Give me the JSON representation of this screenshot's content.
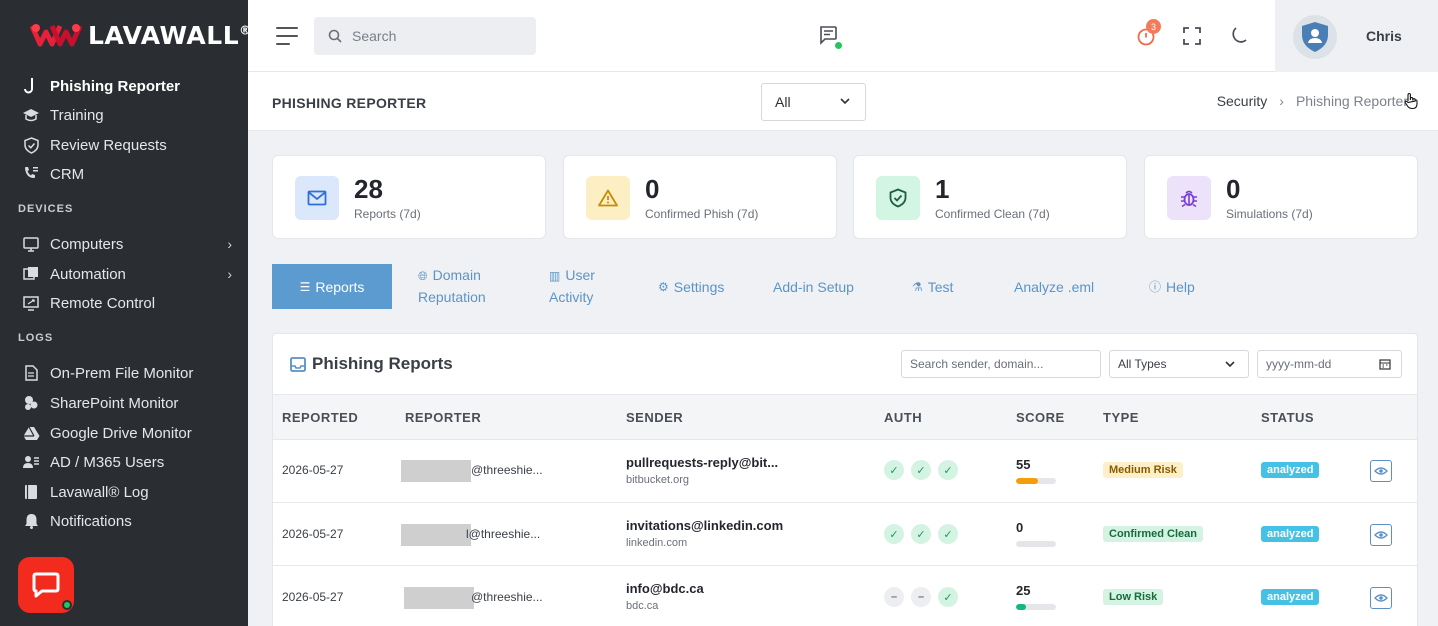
{
  "brand": {
    "name_a": "LAVA",
    "name_b": "WALL",
    "reg": "®"
  },
  "sidebar": {
    "items_top": [
      {
        "label": "Phishing Reporter",
        "icon": "hook-icon",
        "active": true
      },
      {
        "label": "Training",
        "icon": "graduation-cap-icon"
      },
      {
        "label": "Review Requests",
        "icon": "shield-check-icon"
      },
      {
        "label": "CRM",
        "icon": "phone-book-icon"
      }
    ],
    "section_devices": "DEVICES",
    "items_devices": [
      {
        "label": "Computers",
        "icon": "monitor-icon",
        "has_submenu": true
      },
      {
        "label": "Automation",
        "icon": "automation-icon",
        "has_submenu": true
      },
      {
        "label": "Remote Control",
        "icon": "remote-screen-icon"
      }
    ],
    "section_logs": "LOGS",
    "items_logs": [
      {
        "label": "On-Prem File Monitor",
        "icon": "file-icon"
      },
      {
        "label": "SharePoint Monitor",
        "icon": "sharepoint-icon"
      },
      {
        "label": "Google Drive Monitor",
        "icon": "drive-icon"
      },
      {
        "label": "AD / M365 Users",
        "icon": "users-icon"
      },
      {
        "label": "Lavawall® Log",
        "icon": "log-icon"
      },
      {
        "label": "Notifications",
        "icon": "bell-icon"
      }
    ]
  },
  "topbar": {
    "search_placeholder": "Search",
    "timer_badge": "3",
    "user_name": "Chris"
  },
  "pagehead": {
    "title": "PHISHING REPORTER",
    "filter_value": "All",
    "breadcrumb": [
      "Security",
      "Phishing Reporter"
    ]
  },
  "stats": [
    {
      "value": "28",
      "label": "Reports (7d)",
      "icon": "mail-icon",
      "bg": "#dbe7fb",
      "fg": "#2f6fd8"
    },
    {
      "value": "0",
      "label": "Confirmed Phish (7d)",
      "icon": "warning-icon",
      "bg": "#fcefc4",
      "fg": "#c98a06"
    },
    {
      "value": "1",
      "label": "Confirmed Clean (7d)",
      "icon": "shield-check-icon",
      "bg": "#d3f5e3",
      "fg": "#1c9a55"
    },
    {
      "value": "0",
      "label": "Simulations (7d)",
      "icon": "bug-icon",
      "bg": "#ece3fb",
      "fg": "#7a3fd0"
    }
  ],
  "tabs": [
    {
      "label": "Reports",
      "icon": "list-icon",
      "active": true
    },
    {
      "label_a": "Domain",
      "label_b": "Reputation",
      "icon": "globe-icon"
    },
    {
      "label_a": "User",
      "label_b": "Activity",
      "icon": "chart-icon"
    },
    {
      "label": "Settings",
      "icon": "gear-icon"
    },
    {
      "label": "Add-in Setup"
    },
    {
      "label": "Test",
      "icon": "flask-icon"
    },
    {
      "label": "Analyze .eml"
    },
    {
      "label": "Help",
      "icon": "help-icon"
    }
  ],
  "panel": {
    "title": "Phishing Reports",
    "search_placeholder": "Search sender, domain...",
    "types_value": "All Types",
    "date_placeholder": "yyyy-mm-dd",
    "columns": [
      "REPORTED",
      "REPORTER",
      "SENDER",
      "AUTH",
      "SCORE",
      "TYPE",
      "STATUS"
    ],
    "rows": [
      {
        "reported": "2026-05-27",
        "reporter": "@threeshie...",
        "sender": "pullrequests-reply@bit...",
        "sender_domain": "bitbucket.org",
        "auth": [
          "ok",
          "ok",
          "ok"
        ],
        "score": "55",
        "score_pct": 55,
        "score_color": "#f59e0b",
        "type": "Medium Risk",
        "type_bg": "#fdf0c9",
        "type_fg": "#8a5a00",
        "status": "analyzed"
      },
      {
        "reported": "2026-05-27",
        "reporter": "l@threeshie...",
        "sender": "invitations@linkedin.com",
        "sender_domain": "linkedin.com",
        "auth": [
          "ok",
          "ok",
          "ok"
        ],
        "score": "0",
        "score_pct": 0,
        "score_color": "#22c55e",
        "type": "Confirmed Clean",
        "type_bg": "#d4f3e2",
        "type_fg": "#176b3d",
        "status": "analyzed"
      },
      {
        "reported": "2026-05-27",
        "reporter": "@threeshie...",
        "sender": "info@bdc.ca",
        "sender_domain": "bdc.ca",
        "auth": [
          "na",
          "na",
          "ok"
        ],
        "score": "25",
        "score_pct": 25,
        "score_color": "#10b981",
        "type": "Low Risk",
        "type_bg": "#d4f3e2",
        "type_fg": "#176b3d",
        "status": "analyzed"
      }
    ]
  }
}
